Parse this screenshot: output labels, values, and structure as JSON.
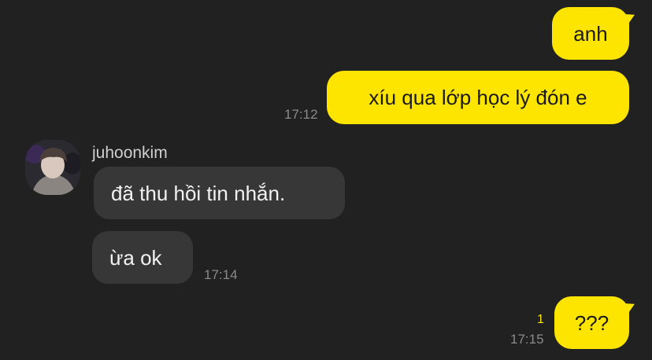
{
  "messages_out": [
    {
      "text": "anh"
    },
    {
      "text": "xíu qua lớp học lý đón e",
      "time": "17:12"
    },
    {
      "text": "???",
      "time": "17:15",
      "unread": "1"
    }
  ],
  "sender": {
    "name": "juhoonkim"
  },
  "messages_in": [
    {
      "text": "đã thu hồi tin nhắn."
    },
    {
      "text": "ừa ok",
      "time": "17:14"
    }
  ],
  "colors": {
    "outgoing_bubble": "#FEE500",
    "incoming_bubble": "#373737",
    "background": "#212121"
  }
}
